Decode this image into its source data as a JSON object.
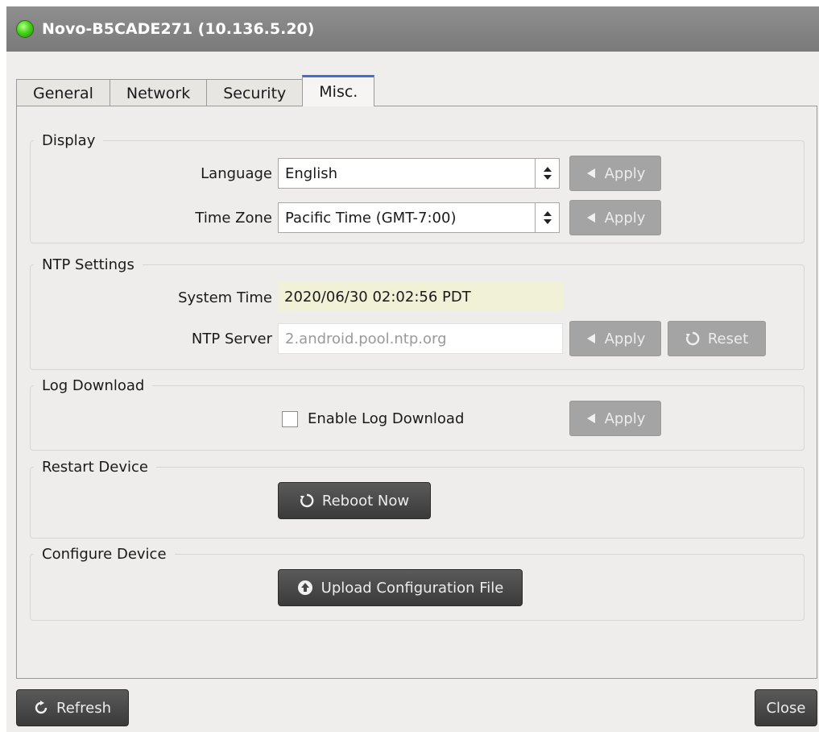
{
  "window": {
    "title": "Novo-B5CADE271 (10.136.5.20)"
  },
  "tabs": [
    {
      "label": "General"
    },
    {
      "label": "Network"
    },
    {
      "label": "Security"
    },
    {
      "label": "Misc."
    }
  ],
  "display": {
    "legend": "Display",
    "language_label": "Language",
    "language_value": "English",
    "timezone_label": "Time Zone",
    "timezone_value": "Pacific Time (GMT-7:00)",
    "apply_label": "Apply"
  },
  "ntp": {
    "legend": "NTP Settings",
    "system_time_label": "System Time",
    "system_time_value": "2020/06/30 02:02:56 PDT",
    "server_label": "NTP Server",
    "server_placeholder": "2.android.pool.ntp.org",
    "apply_label": "Apply",
    "reset_label": "Reset"
  },
  "log": {
    "legend": "Log Download",
    "checkbox_label": "Enable Log Download",
    "checked": false,
    "apply_label": "Apply"
  },
  "restart": {
    "legend": "Restart Device",
    "reboot_label": "Reboot Now"
  },
  "configure": {
    "legend": "Configure Device",
    "upload_label": "Upload Configuration File"
  },
  "footer": {
    "refresh_label": "Refresh",
    "close_label": "Close"
  },
  "icons": {
    "status": "status-online-icon",
    "apply": "chevron-left-icon",
    "reset": "rotate-icon",
    "reboot": "rotate-icon",
    "upload": "upload-circle-icon",
    "refresh": "refresh-icon"
  },
  "colors": {
    "titlebar": "#858585",
    "status_dot": "#49d41a",
    "active_tab_accent": "#3f6fd6",
    "disabled_button": "#a4a4a4",
    "dark_button": "#444444",
    "readonly_bg": "#f1f1d8"
  }
}
